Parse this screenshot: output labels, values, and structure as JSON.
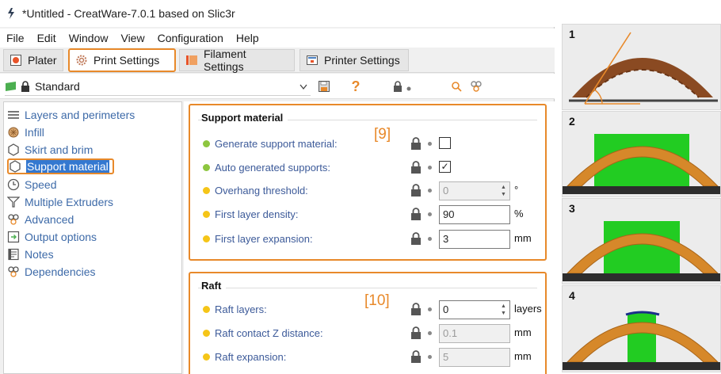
{
  "window": {
    "title": "*Untitled - CreatWare-7.0.1 based on Slic3r"
  },
  "menu": [
    "File",
    "Edit",
    "Window",
    "View",
    "Configuration",
    "Help"
  ],
  "tabs": [
    {
      "label": "Plater",
      "icon": "plater-icon",
      "active": false
    },
    {
      "label": "Print Settings",
      "icon": "gear-icon",
      "active": true
    },
    {
      "label": "Filament Settings",
      "icon": "filament-icon",
      "active": false
    },
    {
      "label": "Printer Settings",
      "icon": "printer-icon",
      "active": false
    }
  ],
  "preset": {
    "name": "Standard",
    "icons": [
      "flag-icon",
      "lock-icon",
      "chevron-down-icon",
      "save-icon",
      "question-icon",
      "lock-dot-icon",
      "search-icon",
      "compare-icon"
    ]
  },
  "sidebar": {
    "items": [
      {
        "label": "Layers and perimeters",
        "icon": "layers-icon"
      },
      {
        "label": "Infill",
        "icon": "infill-icon"
      },
      {
        "label": "Skirt and brim",
        "icon": "skirt-icon"
      },
      {
        "label": "Support material",
        "icon": "support-icon",
        "selected": true
      },
      {
        "label": "Speed",
        "icon": "clock-icon"
      },
      {
        "label": "Multiple Extruders",
        "icon": "extruders-icon"
      },
      {
        "label": "Advanced",
        "icon": "advanced-icon"
      },
      {
        "label": "Output options",
        "icon": "output-icon"
      },
      {
        "label": "Notes",
        "icon": "notes-icon"
      },
      {
        "label": "Dependencies",
        "icon": "dependencies-icon"
      }
    ]
  },
  "support_group": {
    "title": "Support material",
    "tag": "[9]",
    "rows": [
      {
        "label": "Generate support material:",
        "dot": "#8dc63f",
        "type": "checkbox",
        "checked": false
      },
      {
        "label": "Auto generated supports:",
        "dot": "#8dc63f",
        "type": "checkbox",
        "checked": true,
        "check_glyph": "✓"
      },
      {
        "label": "Overhang threshold:",
        "dot": "#f5c518",
        "type": "spin",
        "value": "0",
        "unit": "°",
        "disabled": true
      },
      {
        "label": "First layer density:",
        "dot": "#f5c518",
        "type": "field",
        "value": "90",
        "unit": "%"
      },
      {
        "label": "First layer expansion:",
        "dot": "#f5c518",
        "type": "field",
        "value": "3",
        "unit": "mm"
      }
    ]
  },
  "raft_group": {
    "title": "Raft",
    "tag": "[10]",
    "rows": [
      {
        "label": "Raft layers:",
        "dot": "#f5c518",
        "type": "spin",
        "value": "0",
        "unit": "layers"
      },
      {
        "label": "Raft contact Z distance:",
        "dot": "#f5c518",
        "type": "field",
        "value": "0.1",
        "unit": "mm",
        "disabled": true
      },
      {
        "label": "Raft expansion:",
        "dot": "#f5c518",
        "type": "field",
        "value": "5",
        "unit": "mm",
        "disabled": true
      }
    ]
  },
  "gallery": {
    "panels": [
      {
        "num": "1"
      },
      {
        "num": "2"
      },
      {
        "num": "3"
      },
      {
        "num": "4"
      }
    ]
  },
  "colors": {
    "accent": "#e8892a",
    "selection": "#3478d0",
    "label_blue": "#3c5a99",
    "support_green": "#22cc22",
    "arch_orange": "#d6882a"
  }
}
